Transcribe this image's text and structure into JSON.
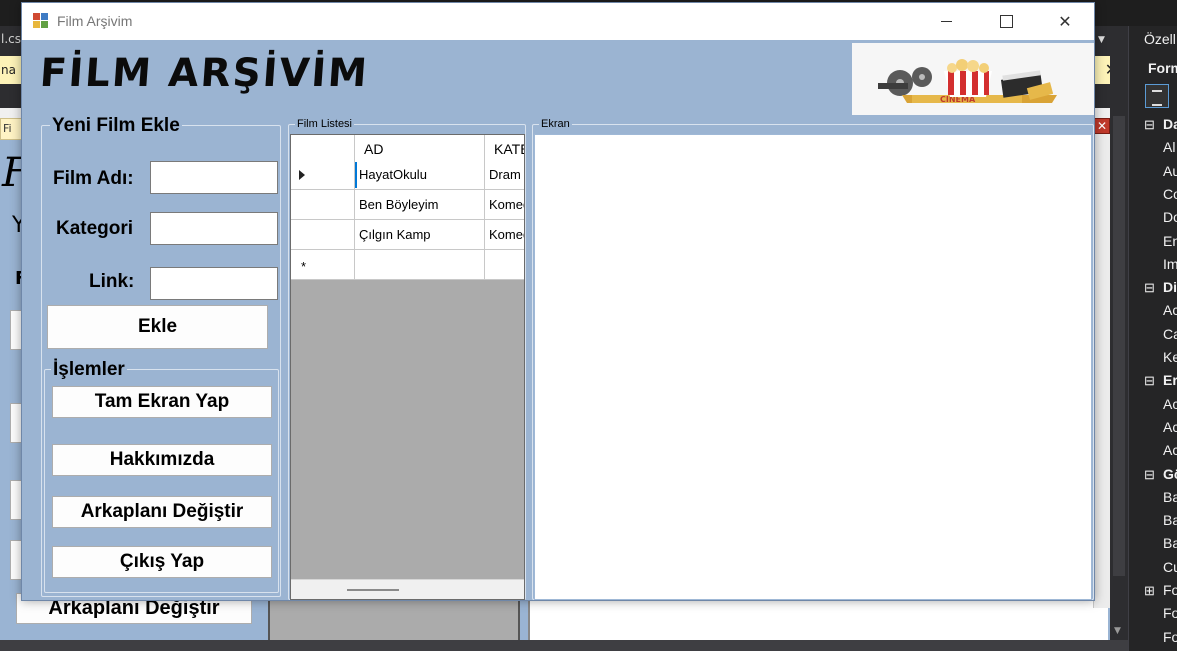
{
  "ide": {
    "tab_left": "l.cs",
    "yellowbar_left": "na",
    "yellowbar_close": "✕",
    "designer_tab": "Fi",
    "bgform_title": "F",
    "bg_y": "Y",
    "bg_f": "F",
    "bg_arkaplan": "Arkaplanı Değiştir",
    "bg_close": "✕",
    "props": {
      "title": "Özell",
      "form": "Form",
      "rows": [
        {
          "type": "cat",
          "sign": "⊟",
          "label": "Da"
        },
        {
          "type": "item",
          "label": "Al"
        },
        {
          "type": "item",
          "label": "Au"
        },
        {
          "type": "item",
          "label": "Co"
        },
        {
          "type": "item",
          "label": "Do"
        },
        {
          "type": "item",
          "label": "En"
        },
        {
          "type": "item",
          "label": "Im"
        },
        {
          "type": "cat",
          "sign": "⊟",
          "label": "Di"
        },
        {
          "type": "item",
          "label": "Ac"
        },
        {
          "type": "item",
          "label": "Ca"
        },
        {
          "type": "item",
          "label": "Ke"
        },
        {
          "type": "cat",
          "sign": "⊟",
          "label": "Er"
        },
        {
          "type": "item",
          "label": "Ac"
        },
        {
          "type": "item",
          "label": "Ac"
        },
        {
          "type": "item",
          "label": "Ac"
        },
        {
          "type": "cat",
          "sign": "⊟",
          "label": "Gö"
        },
        {
          "type": "item",
          "label": "Ba"
        },
        {
          "type": "item",
          "label": "Ba"
        },
        {
          "type": "item",
          "label": "Ba"
        },
        {
          "type": "item",
          "label": "Cu"
        },
        {
          "type": "plus",
          "sign": "⊞",
          "label": "Fo"
        },
        {
          "type": "item",
          "label": "Fo"
        },
        {
          "type": "item",
          "label": "Fo"
        }
      ]
    }
  },
  "window": {
    "title": "Film Arşivim",
    "minimize_label": "",
    "maximize_label": "",
    "close_label": "✕"
  },
  "logo_text": "FİLM ARŞİVİM",
  "banner": {
    "text": "CINEMA"
  },
  "yeni_film": {
    "group_label": "Yeni Film Ekle",
    "film_adi_label": "Film Adı:",
    "film_adi_value": "",
    "kategori_label": "Kategori",
    "kategori_value": "",
    "link_label": "Link:",
    "link_value": "",
    "ekle_button": "Ekle"
  },
  "islemler": {
    "group_label": "İşlemler",
    "buttons": [
      "Tam Ekran Yap",
      "Hakkımızda",
      "Arkaplanı Değiştir",
      "Çıkış Yap"
    ]
  },
  "film_listesi": {
    "group_label": "Film Listesi",
    "columns": [
      "",
      "AD",
      "KATEGORİ"
    ],
    "rows": [
      {
        "ad": "HayatOkulu",
        "kategori": "Dram"
      },
      {
        "ad": "Ben Böyleyim",
        "kategori": "Komedi"
      },
      {
        "ad": "Çılgın Kamp",
        "kategori": "Komedi"
      }
    ],
    "new_row_marker": "*"
  },
  "ekran": {
    "group_label": "Ekran"
  }
}
